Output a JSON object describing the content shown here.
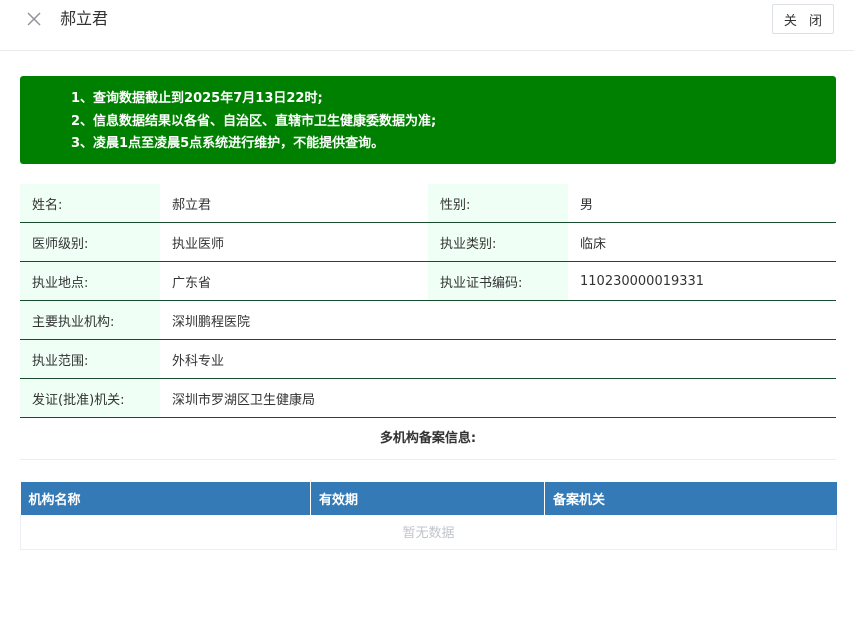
{
  "header": {
    "title": "郝立君",
    "close_label": "关 闭",
    "close_icon": "close-x-icon"
  },
  "notice": {
    "lines": [
      "1、查询数据截止到2025年7月13日22时;",
      "2、信息数据结果以各省、自治区、直辖市卫生健康委数据为准;",
      "3、凌晨1点至凌晨5点系统进行维护，不能提供查询。"
    ],
    "background": "#008000"
  },
  "info": {
    "name_label": "姓名:",
    "name_value": "郝立君",
    "gender_label": "性别:",
    "gender_value": "男",
    "level_label": "医师级别:",
    "level_value": "执业医师",
    "category_label": "执业类别:",
    "category_value": "临床",
    "location_label": "执业地点:",
    "location_value": "广东省",
    "cert_label": "执业证书编码:",
    "cert_value": "110230000019331",
    "institution_label": "主要执业机构:",
    "institution_value": "深圳鹏程医院",
    "scope_label": "执业范围:",
    "scope_value": "外科专业",
    "issuer_label": "发证(批准)机关:",
    "issuer_value": "深圳市罗湖区卫生健康局"
  },
  "records": {
    "section_title": "多机构备案信息:",
    "columns": [
      "机构名称",
      "有效期",
      "备案机关"
    ],
    "empty_text": "暂无数据",
    "header_color": "#337ab7"
  }
}
